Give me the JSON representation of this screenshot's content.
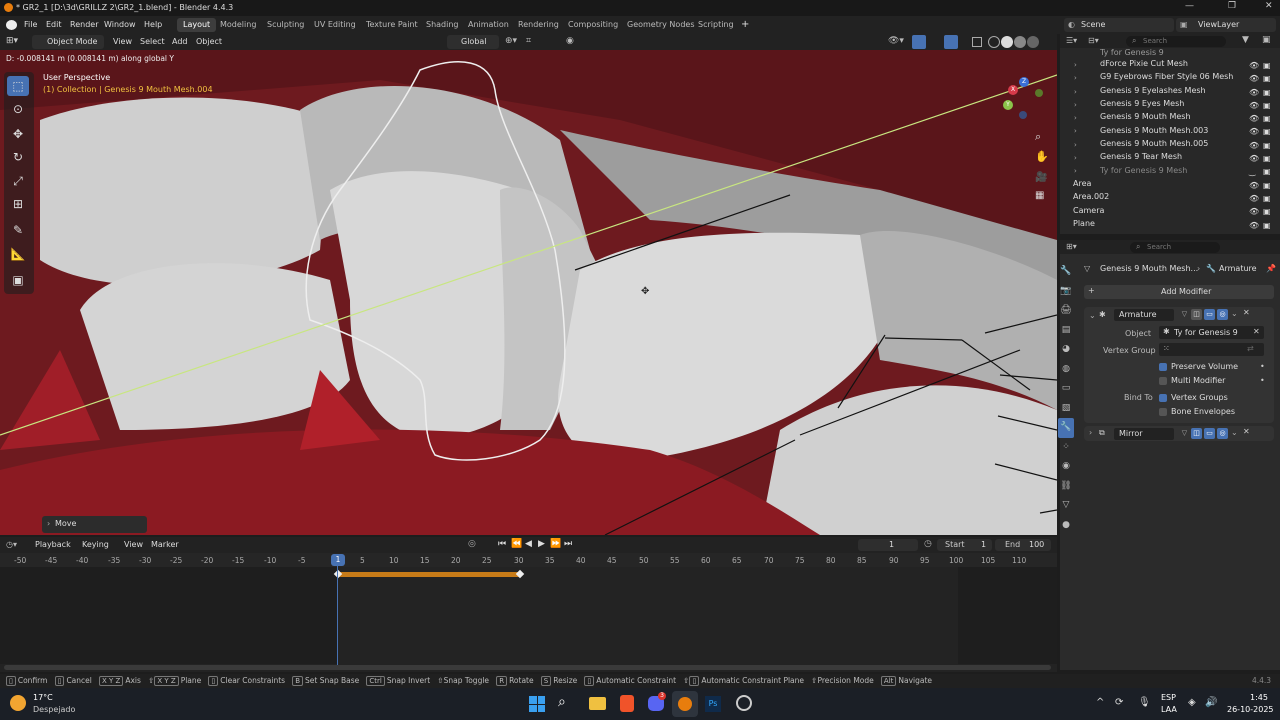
{
  "window": {
    "title": "* GR2_1 [D:\\3d\\GRILLZ 2\\GR2_1.blend] - Blender 4.4.3",
    "controls": [
      "—",
      "❐",
      "✕"
    ]
  },
  "menu": [
    "File",
    "Edit",
    "Render",
    "Window",
    "Help"
  ],
  "workspaces": [
    "Layout",
    "Modeling",
    "Sculpting",
    "UV Editing",
    "Texture Paint",
    "Shading",
    "Animation",
    "Rendering",
    "Compositing",
    "Geometry Nodes",
    "Scripting"
  ],
  "workspace_add": "+",
  "scene": "Scene",
  "view_layer": "ViewLayer",
  "viewport_header": {
    "mode": "Object Mode",
    "menus": [
      "View",
      "Select",
      "Add",
      "Object"
    ],
    "orientation": "Global"
  },
  "transform_info": "D: -0.008141 m (0.008141 m) along global Y",
  "overlay": {
    "perspective": "User Perspective",
    "collection": "(1) Collection | Genesis 9 Mouth Mesh.004"
  },
  "gizmo_axes": [
    "X",
    "Y",
    "Z"
  ],
  "last_operator": "Move",
  "outliner": {
    "search_placeholder": "Search",
    "items": [
      {
        "label": "Ty for Genesis 9"
      },
      {
        "label": "dForce Pixie Cut Mesh"
      },
      {
        "label": "G9 Eyebrows Fiber Style 06 Mesh"
      },
      {
        "label": "Genesis 9 Eyelashes Mesh"
      },
      {
        "label": "Genesis 9 Eyes Mesh"
      },
      {
        "label": "Genesis 9 Mouth Mesh"
      },
      {
        "label": "Genesis 9 Mouth Mesh.003"
      },
      {
        "label": "Genesis 9 Mouth Mesh.005"
      },
      {
        "label": "Genesis 9 Tear Mesh"
      },
      {
        "label": "Ty for Genesis 9 Mesh"
      },
      {
        "label": "Area"
      },
      {
        "label": "Area.002"
      },
      {
        "label": "Camera"
      },
      {
        "label": "Plane"
      }
    ]
  },
  "properties": {
    "search_placeholder": "Search",
    "breadcrumb_object": "Genesis 9 Mouth Mesh...",
    "breadcrumb_sep": "›",
    "breadcrumb_modifier": "Armature",
    "add_modifier": "Add Modifier",
    "armature": {
      "name": "Armature",
      "object_label": "Object",
      "object_value": "Ty for Genesis 9",
      "vertex_group_label": "Vertex Group",
      "preserve_volume": "Preserve Volume",
      "multi_modifier": "Multi Modifier",
      "bind_to_label": "Bind To",
      "vertex_groups": "Vertex Groups",
      "bone_envelopes": "Bone Envelopes"
    },
    "mirror": {
      "name": "Mirror"
    }
  },
  "timeline": {
    "menus": [
      "Playback",
      "Keying",
      "View",
      "Marker"
    ],
    "current_frame": "1",
    "start_label": "Start",
    "start": "1",
    "end_label": "End",
    "end": "100",
    "playhead": "1",
    "ticks": [
      "-50",
      "-45",
      "-40",
      "-35",
      "-30",
      "-25",
      "-20",
      "-15",
      "-10",
      "-5",
      "5",
      "10",
      "15",
      "20",
      "25",
      "30",
      "35",
      "40",
      "45",
      "50",
      "55",
      "60",
      "65",
      "70",
      "75",
      "80",
      "85",
      "90",
      "95",
      "100",
      "105",
      "110"
    ]
  },
  "status": {
    "items": [
      {
        "key": "",
        "label": "Confirm"
      },
      {
        "key": "",
        "label": "Cancel"
      },
      {
        "key": "X Y Z",
        "label": "Axis"
      },
      {
        "key": "X Y Z",
        "label": "Plane"
      },
      {
        "key": "",
        "label": "Clear Constraints"
      },
      {
        "key": "B",
        "label": "Set Snap Base"
      },
      {
        "key": "Ctrl",
        "label": "Snap Invert"
      },
      {
        "key": "",
        "label": "Snap Toggle"
      },
      {
        "key": "R",
        "label": "Rotate"
      },
      {
        "key": "S",
        "label": "Resize"
      },
      {
        "key": "",
        "label": "Automatic Constraint"
      },
      {
        "key": "",
        "label": "Automatic Constraint Plane"
      },
      {
        "key": "",
        "label": "Precision Mode"
      },
      {
        "key": "Alt",
        "label": "Navigate"
      }
    ],
    "version": "4.4.3"
  },
  "taskbar": {
    "temp": "17°C",
    "weather": "Despejado",
    "lang": "ESP",
    "region": "LAA",
    "time": "1:45",
    "date": "26-10-2025",
    "badge": "3"
  },
  "colors": {
    "accent": "#4772b3",
    "active_frame": "#4772b3",
    "keyframe_bar": "#c77b18",
    "selection_line": "#c8e680",
    "mouth_red": "#8b1a22"
  }
}
